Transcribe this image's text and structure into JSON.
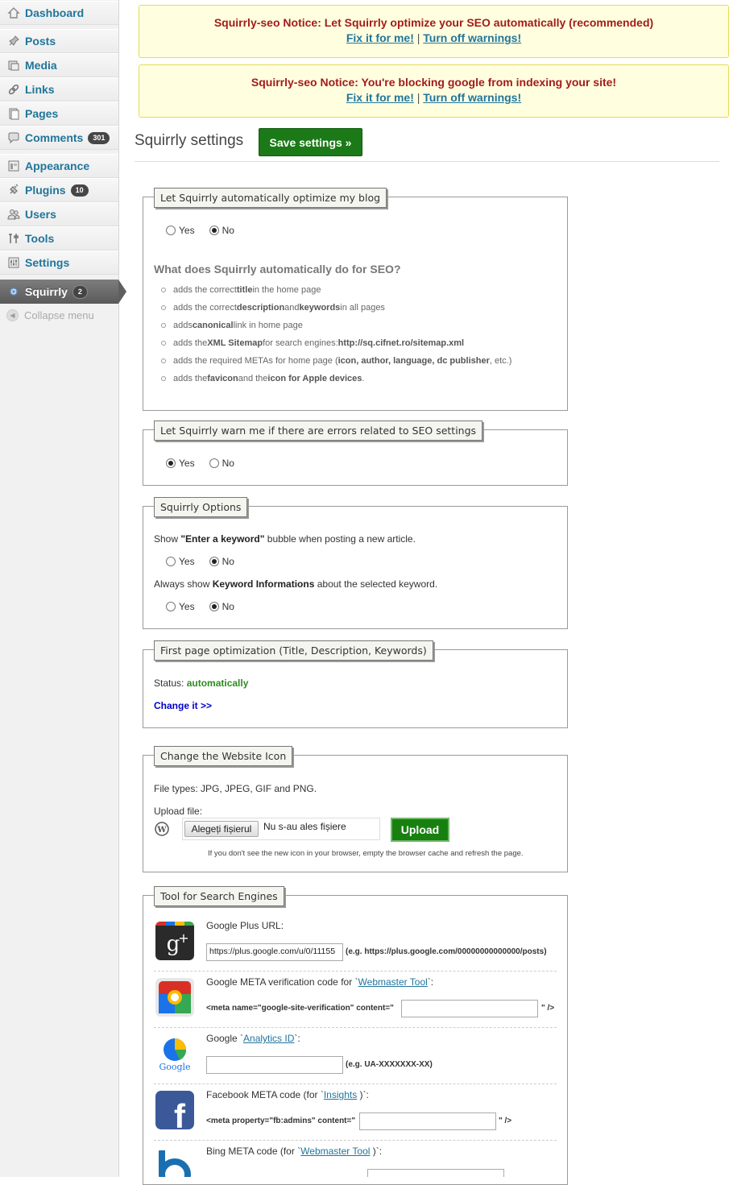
{
  "sidebar": {
    "items": [
      {
        "label": "Dashboard",
        "icon": "dashboard-icon"
      },
      {
        "label": "Posts",
        "icon": "pin-icon"
      },
      {
        "label": "Media",
        "icon": "media-icon"
      },
      {
        "label": "Links",
        "icon": "link-icon"
      },
      {
        "label": "Pages",
        "icon": "pages-icon"
      },
      {
        "label": "Comments",
        "icon": "comment-icon",
        "count": "301"
      },
      {
        "label": "Appearance",
        "icon": "appearance-icon"
      },
      {
        "label": "Plugins",
        "icon": "plugin-icon",
        "count": "10"
      },
      {
        "label": "Users",
        "icon": "users-icon"
      },
      {
        "label": "Tools",
        "icon": "tools-icon"
      },
      {
        "label": "Settings",
        "icon": "settings-icon"
      },
      {
        "label": "Squirrly",
        "icon": "gear-icon",
        "count": "2",
        "active": true
      }
    ],
    "collapse_label": "Collapse menu"
  },
  "notices": [
    {
      "text": "Squirrly-seo Notice: Let Squirrly optimize your SEO automatically (recommended)",
      "fix": "Fix it for me!",
      "sep": "|",
      "off": "Turn off warnings!"
    },
    {
      "text": "Squirrly-seo Notice: You're blocking google from indexing your site!",
      "fix": "Fix it for me!",
      "sep": "|",
      "off": "Turn off warnings!"
    }
  ],
  "header": {
    "title": "Squirrly settings",
    "save_label": "Save settings »"
  },
  "auto_box": {
    "legend": "Let Squirrly automatically optimize my blog",
    "yes": "Yes",
    "no": "No",
    "selected": "No",
    "heading": "What does Squirrly automatically do for SEO?",
    "bullets": [
      {
        "pre": "adds the correct ",
        "b1": "title",
        "mid": " in the home page",
        "b2": "",
        "post": ""
      },
      {
        "pre": "adds the correct ",
        "b1": "description",
        "mid": " and ",
        "b2": "keywords",
        "post": " in all pages"
      },
      {
        "pre": "adds ",
        "b1": "canonical",
        "mid": " link in home page",
        "b2": "",
        "post": ""
      },
      {
        "pre": "adds the ",
        "b1": "XML Sitemap",
        "mid": " for search engines: ",
        "b2": "http://sq.cifnet.ro/sitemap.xml",
        "post": ""
      },
      {
        "pre": "adds the required METAs for home page (",
        "b1": "icon, author, language, dc publisher",
        "mid": ", etc.)",
        "b2": "",
        "post": ""
      },
      {
        "pre": "adds the ",
        "b1": "favicon",
        "mid": " and the ",
        "b2": "icon for Apple devices",
        "post": "."
      }
    ]
  },
  "warn_box": {
    "legend": "Let Squirrly warn me if there are errors related to SEO settings",
    "yes": "Yes",
    "no": "No",
    "selected": "Yes"
  },
  "options_box": {
    "legend": "Squirrly Options",
    "opt1_pre": "Show ",
    "opt1_b": "\"Enter a keyword\"",
    "opt1_post": " bubble when posting a new article.",
    "opt2_pre": "Always show ",
    "opt2_b": "Keyword Informations",
    "opt2_post": " about the selected keyword.",
    "yes": "Yes",
    "no": "No",
    "opt1_selected": "No",
    "opt2_selected": "No"
  },
  "first_page_box": {
    "legend": "First page optimization (Title, Description, Keywords)",
    "status_label": "Status: ",
    "status_value": "automatically",
    "change_link": "Change it >>"
  },
  "icon_box": {
    "legend": "Change the Website Icon",
    "file_types": "File types: JPG, JPEG, GIF and PNG.",
    "upload_label": "Upload file:",
    "choose_button": "Alegeți fișierul",
    "no_file": "Nu s-au ales fișiere",
    "upload_button": "Upload",
    "hint": "If you don't see the new icon in your browser, empty the browser cache and refresh the page."
  },
  "tools_box": {
    "legend": "Tool for Search Engines",
    "rows": [
      {
        "label_pre": "Google Plus URL:",
        "link": "",
        "label_post": "",
        "icon": "google-plus-icon",
        "value": "https://plus.google.com/u/0/11155",
        "pre_input": "",
        "post_input": "(e.g. https://plus.google.com/00000000000000/posts)"
      },
      {
        "label_pre": "Google META verification code for `",
        "link": "Webmaster Tool",
        "label_post": "`:",
        "icon": "google-webmaster-icon",
        "value": "",
        "pre_input": "<meta name=\"google-site-verification\" content=\"",
        "post_input": "\" />"
      },
      {
        "label_pre": "Google `",
        "link": "Analytics ID",
        "label_post": "`:",
        "icon": "google-analytics-icon",
        "value": "",
        "pre_input": "",
        "post_input": "(e.g. UA-XXXXXXX-XX)"
      },
      {
        "label_pre": "Facebook META code (for `",
        "link": "Insights",
        "label_post": " )`:",
        "icon": "facebook-icon",
        "value": "",
        "pre_input": "<meta property=\"fb:admins\" content=\"",
        "post_input": "\" />"
      },
      {
        "label_pre": "Bing META code (for `",
        "link": "Webmaster Tool",
        "label_post": " )`:",
        "icon": "bing-icon",
        "value": "",
        "pre_input": "",
        "post_input": ""
      }
    ]
  },
  "colors": {
    "accent": "#21759b",
    "save_green": "#1b7a17",
    "notice_bg": "#ffffe0",
    "notice_text": "#a31b1b",
    "status_green": "#2e8b1f"
  }
}
